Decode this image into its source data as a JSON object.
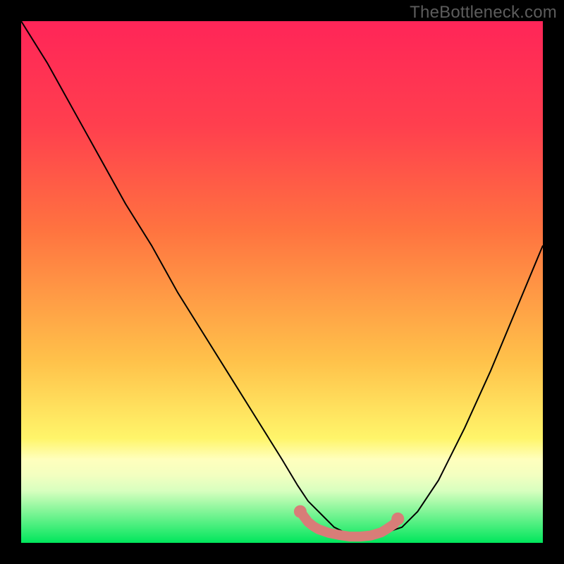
{
  "watermark": "TheBottleneck.com",
  "chart_data": {
    "type": "line",
    "title": "",
    "xlabel": "",
    "ylabel": "",
    "xlim": [
      0,
      100
    ],
    "ylim": [
      0,
      100
    ],
    "background_gradient_y": [
      0,
      10,
      13,
      16,
      20,
      35,
      60,
      80,
      100
    ],
    "background_gradient_color": [
      "#00e65c",
      "#d8ffbf",
      "#f3ffc0",
      "#ffffbd",
      "#fff56a",
      "#ffc14a",
      "#ff7340",
      "#ff3f4e",
      "#ff2558"
    ],
    "curve": {
      "x": [
        0,
        5,
        10,
        15,
        20,
        25,
        30,
        35,
        40,
        45,
        50,
        53,
        55,
        58,
        60,
        62,
        65,
        68,
        70,
        73,
        76,
        80,
        85,
        90,
        95,
        100
      ],
      "y": [
        100,
        92,
        83,
        74,
        65,
        57,
        48,
        40,
        32,
        24,
        16,
        11,
        8,
        5,
        3,
        2,
        1,
        1,
        2,
        3,
        6,
        12,
        22,
        33,
        45,
        57
      ]
    },
    "trough_highlight": {
      "color": "#d87d78",
      "x": [
        53.5,
        55,
        56,
        57,
        59,
        61,
        63,
        65,
        67,
        69,
        70,
        71.5,
        72.2
      ],
      "y": [
        6.0,
        4.0,
        3.2,
        2.6,
        1.9,
        1.5,
        1.2,
        1.2,
        1.4,
        2.0,
        2.6,
        3.6,
        4.6
      ]
    }
  }
}
